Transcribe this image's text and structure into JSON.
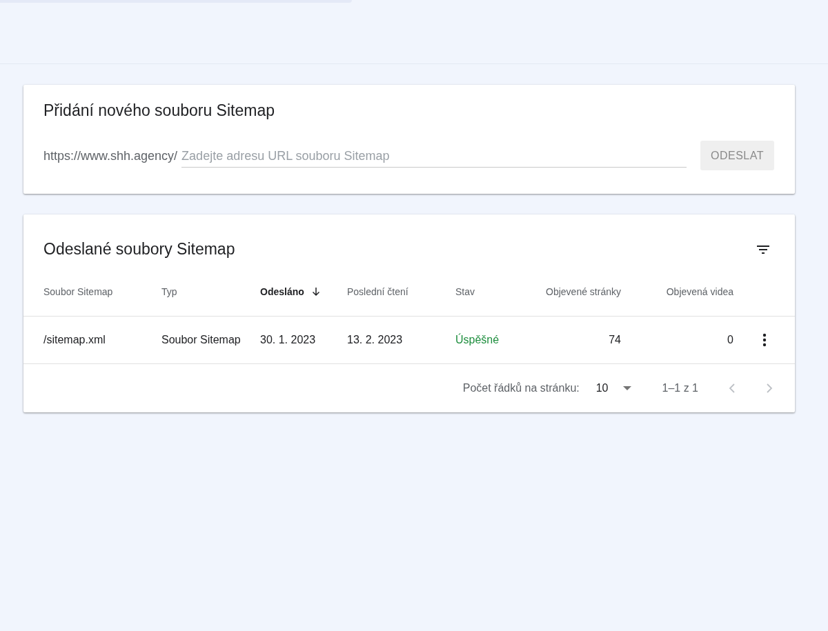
{
  "add_card": {
    "title": "Přidání nového souboru Sitemap",
    "url_prefix": "https://www.shh.agency/",
    "field": {
      "placeholder": "Zadejte adresu URL souboru Sitemap"
    },
    "submit": {
      "label": "ODESLAT",
      "disabled": true
    }
  },
  "list_card": {
    "title": "Odeslané soubory Sitemap",
    "columns": [
      {
        "label": "Soubor Sitemap",
        "kind": "text",
        "selected": false
      },
      {
        "label": "Typ",
        "kind": "text",
        "selected": false
      },
      {
        "label": "Odesláno",
        "kind": "text",
        "selected": true
      },
      {
        "label": "Poslední čtení",
        "kind": "text",
        "selected": false
      },
      {
        "label": "Stav",
        "kind": "text",
        "selected": false
      },
      {
        "label": "Objevené stránky",
        "kind": "number",
        "selected": false
      },
      {
        "label": "Objevená videa",
        "kind": "number",
        "selected": false
      }
    ],
    "rows": [
      {
        "cells": [
          "/sitemap.xml",
          "Soubor Sitemap",
          "30. 1. 2023",
          "13. 2. 2023",
          "Úspěšné",
          "74",
          "0"
        ],
        "color": "#1e8e3e"
      }
    ],
    "pagination": {
      "rows_label": "Počet řádků na stránku:",
      "rows_value": "10",
      "range": "1–1 z 1",
      "prev_disabled": true,
      "next_disabled": true
    }
  }
}
